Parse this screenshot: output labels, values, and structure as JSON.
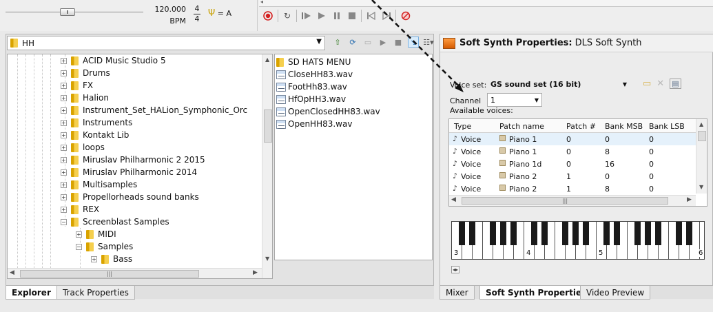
{
  "transport": {
    "tempo_value": "120.000",
    "tempo_unit": "BPM",
    "timesig_top": "4",
    "timesig_bottom": "4",
    "tuning_label": "= A",
    "colors": {
      "record": "#d42020",
      "stop": "#d42020"
    }
  },
  "explorer": {
    "address": "HH",
    "tree_items": [
      {
        "label": "ACID Music Studio 5",
        "expanded": false,
        "level": 0
      },
      {
        "label": "Drums",
        "expanded": false,
        "level": 0
      },
      {
        "label": "FX",
        "expanded": false,
        "level": 0
      },
      {
        "label": "Halion",
        "expanded": false,
        "level": 0
      },
      {
        "label": "Instrument_Set_HALion_Symphonic_Orc",
        "expanded": false,
        "level": 0
      },
      {
        "label": "Instruments",
        "expanded": false,
        "level": 0
      },
      {
        "label": "Kontakt Lib",
        "expanded": false,
        "level": 0
      },
      {
        "label": "loops",
        "expanded": false,
        "level": 0
      },
      {
        "label": "Miruslav Philharmonic 2 2015",
        "expanded": false,
        "level": 0
      },
      {
        "label": "Miruslav Philharmonic 2014",
        "expanded": false,
        "level": 0
      },
      {
        "label": "Multisamples",
        "expanded": false,
        "level": 0
      },
      {
        "label": "Propellorheads sound banks",
        "expanded": false,
        "level": 0
      },
      {
        "label": "REX",
        "expanded": false,
        "level": 0
      },
      {
        "label": "Screenblast Samples",
        "expanded": true,
        "level": 0
      },
      {
        "label": "MIDI",
        "expanded": false,
        "level": 1
      },
      {
        "label": "Samples",
        "expanded": true,
        "level": 1
      },
      {
        "label": "Bass",
        "expanded": false,
        "level": 2
      }
    ],
    "files": [
      {
        "label": "SD HATS MENU",
        "kind": "folder"
      },
      {
        "label": "CloseHH83.wav",
        "kind": "wav"
      },
      {
        "label": "FootHh83.wav",
        "kind": "wav"
      },
      {
        "label": "HfOpHH3.wav",
        "kind": "wav"
      },
      {
        "label": "OpenClosedHH83.wav",
        "kind": "wav"
      },
      {
        "label": "OpenHH83.wav",
        "kind": "wav"
      }
    ],
    "tabs": [
      {
        "label": "Explorer",
        "active": true
      },
      {
        "label": "Track Properties",
        "active": false
      }
    ]
  },
  "softsynth": {
    "title": "Soft Synth Properties:",
    "title_sub": "DLS Soft Synth",
    "voice_set_label": "Voice set:",
    "voice_set_value": "GS sound set (16 bit)",
    "channel_label": "Channel",
    "channel_value": "1",
    "available_voices_label": "Available voices:",
    "columns": [
      "Type",
      "Patch name",
      "Patch #",
      "Bank MSB",
      "Bank LSB"
    ],
    "voices": [
      {
        "type": "Voice",
        "patch_name": "Piano 1",
        "patch_no": "0",
        "bank_msb": "0",
        "bank_lsb": "0"
      },
      {
        "type": "Voice",
        "patch_name": "Piano 1",
        "patch_no": "0",
        "bank_msb": "8",
        "bank_lsb": "0"
      },
      {
        "type": "Voice",
        "patch_name": "Piano 1d",
        "patch_no": "0",
        "bank_msb": "16",
        "bank_lsb": "0"
      },
      {
        "type": "Voice",
        "patch_name": "Piano 2",
        "patch_no": "1",
        "bank_msb": "0",
        "bank_lsb": "0"
      },
      {
        "type": "Voice",
        "patch_name": "Piano 2",
        "patch_no": "1",
        "bank_msb": "8",
        "bank_lsb": "0"
      }
    ],
    "keyboard_octaves": [
      "3",
      "4",
      "5",
      "6"
    ],
    "tabs": [
      {
        "label": "Mixer",
        "active": false
      },
      {
        "label": "Soft Synth Properties",
        "active": true
      },
      {
        "label": "Video Preview",
        "active": false
      }
    ]
  }
}
